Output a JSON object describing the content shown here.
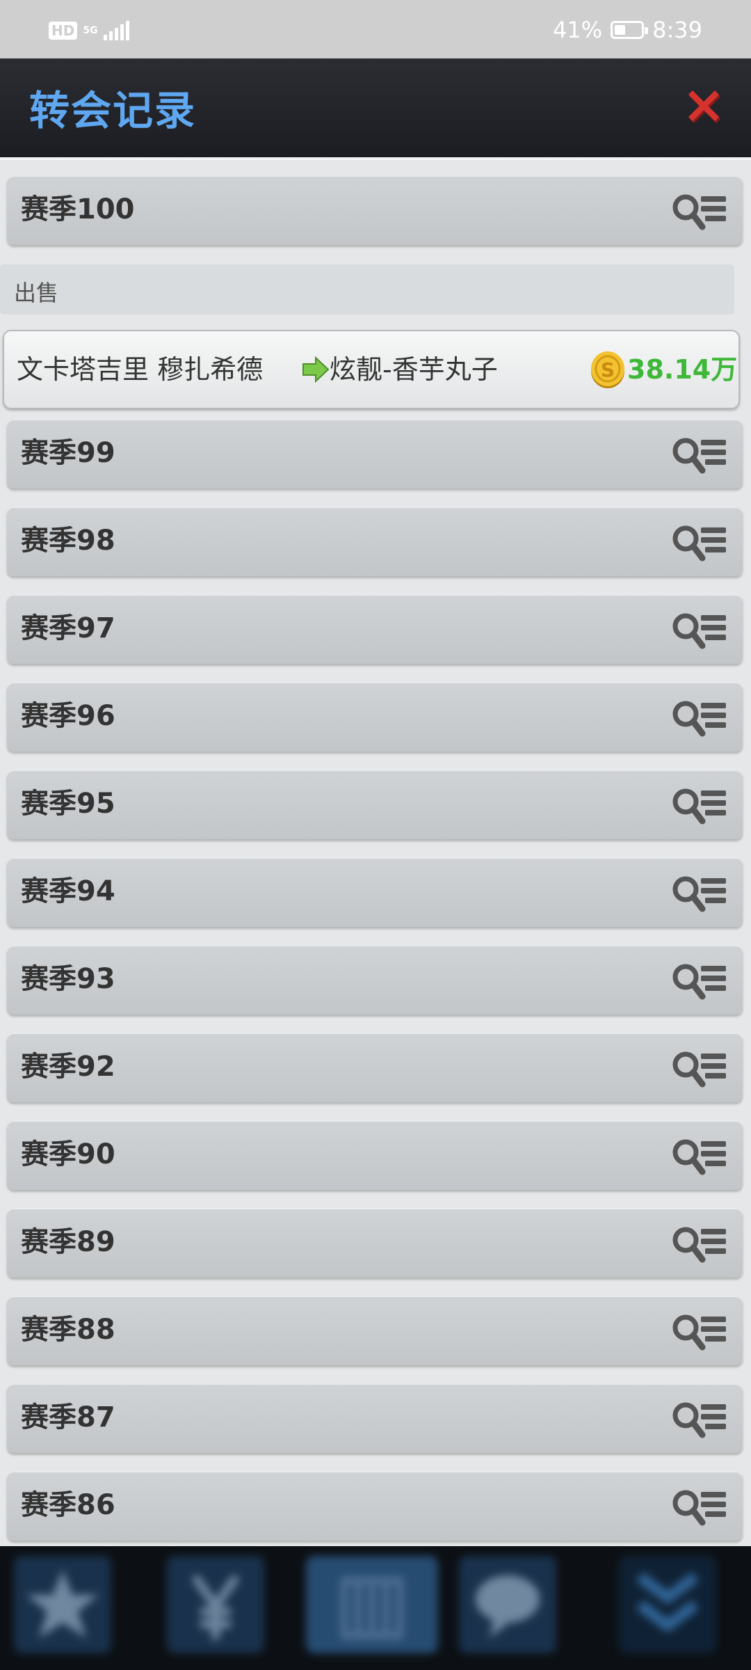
{
  "status_bar": {
    "hd": "HD",
    "network": "5G",
    "battery_text": "41%",
    "battery_level": 41,
    "time": "8:39"
  },
  "header": {
    "title": "转会记录"
  },
  "seasons": [
    {
      "label": "赛季100"
    },
    {
      "label": "赛季99"
    },
    {
      "label": "赛季98"
    },
    {
      "label": "赛季97"
    },
    {
      "label": "赛季96"
    },
    {
      "label": "赛季95"
    },
    {
      "label": "赛季94"
    },
    {
      "label": "赛季93"
    },
    {
      "label": "赛季92"
    },
    {
      "label": "赛季90"
    },
    {
      "label": "赛季89"
    },
    {
      "label": "赛季88"
    },
    {
      "label": "赛季87"
    },
    {
      "label": "赛季86"
    }
  ],
  "expanded": {
    "section_label": "出售",
    "record": {
      "player": "文卡塔吉里 穆扎希德",
      "club": "炫靓-香芋丸子",
      "price": "38.14万"
    }
  },
  "icons": {
    "close": "close-icon",
    "search_list": "search-list-icon",
    "arrow": "arrow-right-icon",
    "coin": "coin-icon"
  },
  "colors": {
    "title": "#5fa7f0",
    "price": "#3fb83a",
    "close": "#d6332e"
  }
}
